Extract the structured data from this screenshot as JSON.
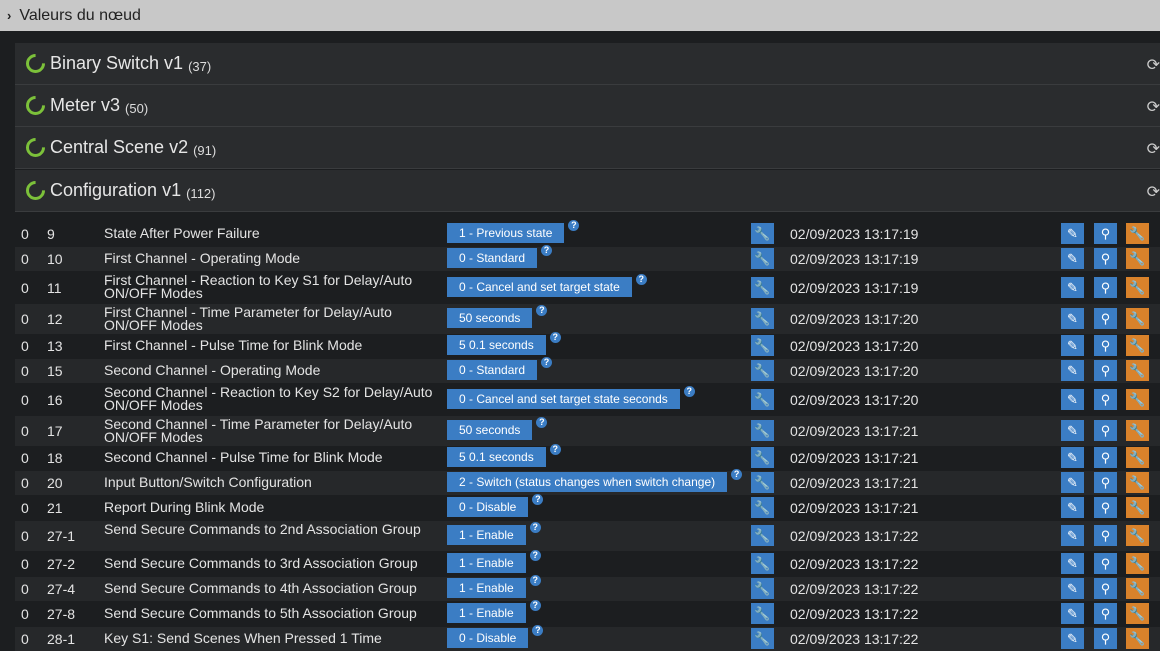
{
  "header": {
    "title": "Valeurs du nœud"
  },
  "panels": [
    {
      "title": "Binary Switch v1",
      "count": "(37)"
    },
    {
      "title": "Meter v3",
      "count": "(50)"
    },
    {
      "title": "Central Scene v2",
      "count": "(91)"
    },
    {
      "title": "Configuration v1",
      "count": "(112)"
    }
  ],
  "rows": [
    {
      "instance": "0",
      "index": "9",
      "label": "State After Power Failure",
      "value": "1 - Previous state",
      "date": "02/09/2023 13:17:19"
    },
    {
      "instance": "0",
      "index": "10",
      "label": "First Channel - Operating Mode",
      "value": "0 - Standard",
      "date": "02/09/2023 13:17:19"
    },
    {
      "instance": "0",
      "index": "11",
      "label": "First Channel - Reaction to Key S1 for Delay/Auto ON/OFF Modes",
      "value": "0 - Cancel and set target state",
      "date": "02/09/2023 13:17:19"
    },
    {
      "instance": "0",
      "index": "12",
      "label": "First Channel - Time Parameter for Delay/Auto ON/OFF Modes",
      "value": "50 seconds",
      "date": "02/09/2023 13:17:20"
    },
    {
      "instance": "0",
      "index": "13",
      "label": "First Channel - Pulse Time for Blink Mode",
      "value": "5 0.1 seconds",
      "date": "02/09/2023 13:17:20"
    },
    {
      "instance": "0",
      "index": "15",
      "label": "Second Channel - Operating Mode",
      "value": "0 - Standard",
      "date": "02/09/2023 13:17:20"
    },
    {
      "instance": "0",
      "index": "16",
      "label": "Second Channel - Reaction to Key S2 for Delay/Auto ON/OFF Modes",
      "value": "0 - Cancel and set target state seconds",
      "date": "02/09/2023 13:17:20"
    },
    {
      "instance": "0",
      "index": "17",
      "label": "Second Channel - Time Parameter for Delay/Auto ON/OFF Modes",
      "value": "50 seconds",
      "date": "02/09/2023 13:17:21"
    },
    {
      "instance": "0",
      "index": "18",
      "label": "Second Channel - Pulse Time for Blink Mode",
      "value": "5 0.1 seconds",
      "date": "02/09/2023 13:17:21"
    },
    {
      "instance": "0",
      "index": "20",
      "label": "Input Button/Switch Configuration",
      "value": "2 - Switch (status changes when switch change)",
      "date": "02/09/2023 13:17:21"
    },
    {
      "instance": "0",
      "index": "21",
      "label": "Report During Blink Mode",
      "value": "0 - Disable",
      "date": "02/09/2023 13:17:21"
    },
    {
      "instance": "0",
      "index": "27-1",
      "label": "Send Secure Commands to 2nd Association Group",
      "value": "1 - Enable",
      "date": "02/09/2023 13:17:22"
    },
    {
      "instance": "0",
      "index": "27-2",
      "label": "Send Secure Commands to 3rd Association Group",
      "value": "1 - Enable",
      "date": "02/09/2023 13:17:22"
    },
    {
      "instance": "0",
      "index": "27-4",
      "label": "Send Secure Commands to 4th Association Group",
      "value": "1 - Enable",
      "date": "02/09/2023 13:17:22"
    },
    {
      "instance": "0",
      "index": "27-8",
      "label": "Send Secure Commands to 5th Association Group",
      "value": "1 - Enable",
      "date": "02/09/2023 13:17:22"
    },
    {
      "instance": "0",
      "index": "28-1",
      "label": "Key S1: Send Scenes When Pressed 1 Time",
      "value": "0 - Disable",
      "date": "02/09/2023 13:17:22"
    }
  ],
  "icons": {
    "help": "?",
    "wrench": "wrench-icon",
    "edit": "pencil-icon",
    "picker": "eyedropper-icon",
    "settings": "wrench-icon",
    "refresh": "refresh-icon"
  },
  "colors": {
    "accent": "#3b7dc4",
    "action": "#d9822b",
    "status": "#7cc13a"
  }
}
